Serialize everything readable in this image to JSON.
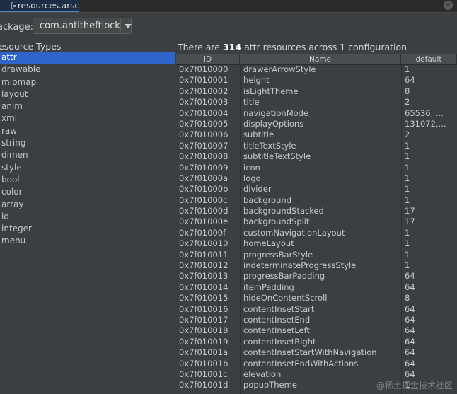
{
  "tab": {
    "title": "resources.arsc"
  },
  "package": {
    "label": "ackage:",
    "value": "com.antitheftlock"
  },
  "types": {
    "header": "esource Types",
    "items": [
      "attr",
      "drawable",
      "mipmap",
      "layout",
      "anim",
      "xml",
      "raw",
      "string",
      "dimen",
      "style",
      "bool",
      "color",
      "array",
      "id",
      "integer",
      "menu"
    ],
    "selected": "attr"
  },
  "summary": {
    "prefix": "There are",
    "count": "314",
    "suffix": "attr resources across 1 configuration"
  },
  "table": {
    "columns": [
      "ID",
      "Name",
      "default"
    ],
    "rows": [
      [
        "0x7f010000",
        "drawerArrowStyle",
        "1"
      ],
      [
        "0x7f010001",
        "height",
        "64"
      ],
      [
        "0x7f010002",
        "isLightTheme",
        "8"
      ],
      [
        "0x7f010003",
        "title",
        "2"
      ],
      [
        "0x7f010004",
        "navigationMode",
        "65536, ..."
      ],
      [
        "0x7f010005",
        "displayOptions",
        "131072,..."
      ],
      [
        "0x7f010006",
        "subtitle",
        "2"
      ],
      [
        "0x7f010007",
        "titleTextStyle",
        "1"
      ],
      [
        "0x7f010008",
        "subtitleTextStyle",
        "1"
      ],
      [
        "0x7f010009",
        "icon",
        "1"
      ],
      [
        "0x7f01000a",
        "logo",
        "1"
      ],
      [
        "0x7f01000b",
        "divider",
        "1"
      ],
      [
        "0x7f01000c",
        "background",
        "1"
      ],
      [
        "0x7f01000d",
        "backgroundStacked",
        "17"
      ],
      [
        "0x7f01000e",
        "backgroundSplit",
        "17"
      ],
      [
        "0x7f01000f",
        "customNavigationLayout",
        "1"
      ],
      [
        "0x7f010010",
        "homeLayout",
        "1"
      ],
      [
        "0x7f010011",
        "progressBarStyle",
        "1"
      ],
      [
        "0x7f010012",
        "indeterminateProgressStyle",
        "1"
      ],
      [
        "0x7f010013",
        "progressBarPadding",
        "64"
      ],
      [
        "0x7f010014",
        "itemPadding",
        "64"
      ],
      [
        "0x7f010015",
        "hideOnContentScroll",
        "8"
      ],
      [
        "0x7f010016",
        "contentInsetStart",
        "64"
      ],
      [
        "0x7f010017",
        "contentInsetEnd",
        "64"
      ],
      [
        "0x7f010018",
        "contentInsetLeft",
        "64"
      ],
      [
        "0x7f010019",
        "contentInsetRight",
        "64"
      ],
      [
        "0x7f01001a",
        "contentInsetStartWithNavigation",
        "64"
      ],
      [
        "0x7f01001b",
        "contentInsetEndWithActions",
        "64"
      ],
      [
        "0x7f01001c",
        "elevation",
        "64"
      ],
      [
        "0x7f01001d",
        "popupTheme",
        "1"
      ]
    ]
  },
  "watermark": "@稀土掘金技术社区",
  "colors": {
    "selection": "#2f65ca",
    "background": "#3c3f41",
    "tab_active": "#1f2e47"
  }
}
